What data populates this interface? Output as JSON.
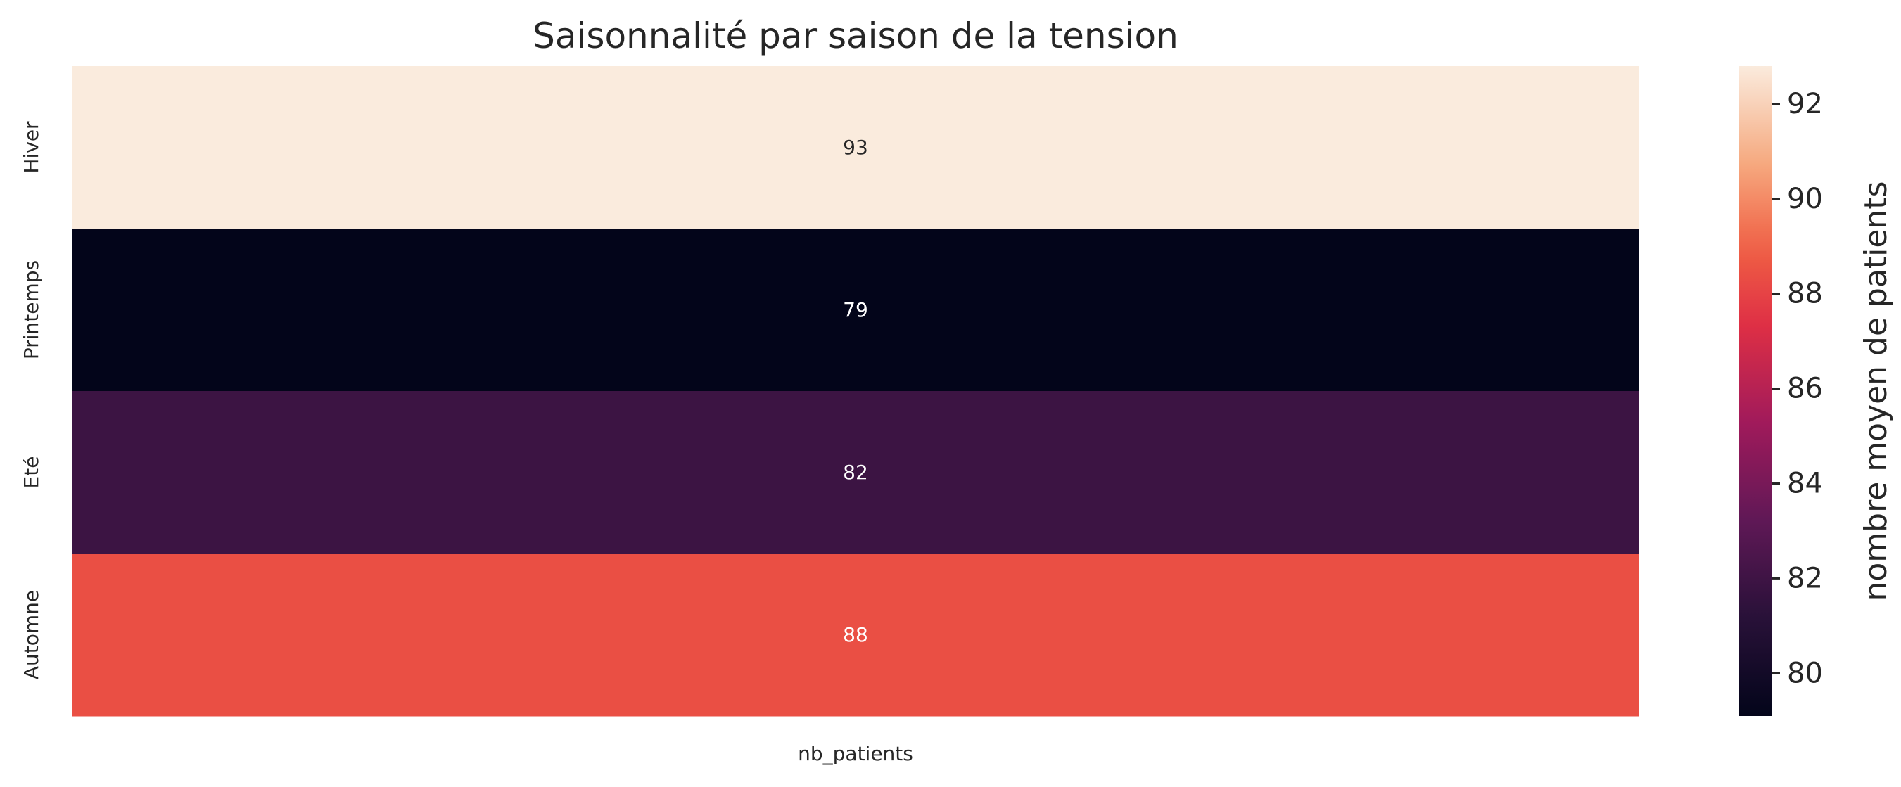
{
  "chart_data": {
    "type": "heatmap",
    "title": "Saisonnalité par saison de la tension",
    "rows": [
      "Hiver",
      "Printemps",
      "Eté",
      "Automne"
    ],
    "columns": [
      "nb_patients"
    ],
    "values": [
      [
        92.8
      ],
      [
        79.1
      ],
      [
        81.9
      ],
      [
        88.4
      ]
    ],
    "cell_labels": [
      "93",
      "79",
      "82",
      "88"
    ],
    "colormap": "rocket",
    "colorbar": {
      "label": "nombre moyen de patients",
      "range": [
        79.1,
        92.8
      ],
      "ticks": [
        "80",
        "82",
        "84",
        "86",
        "88",
        "90",
        "92"
      ]
    }
  }
}
